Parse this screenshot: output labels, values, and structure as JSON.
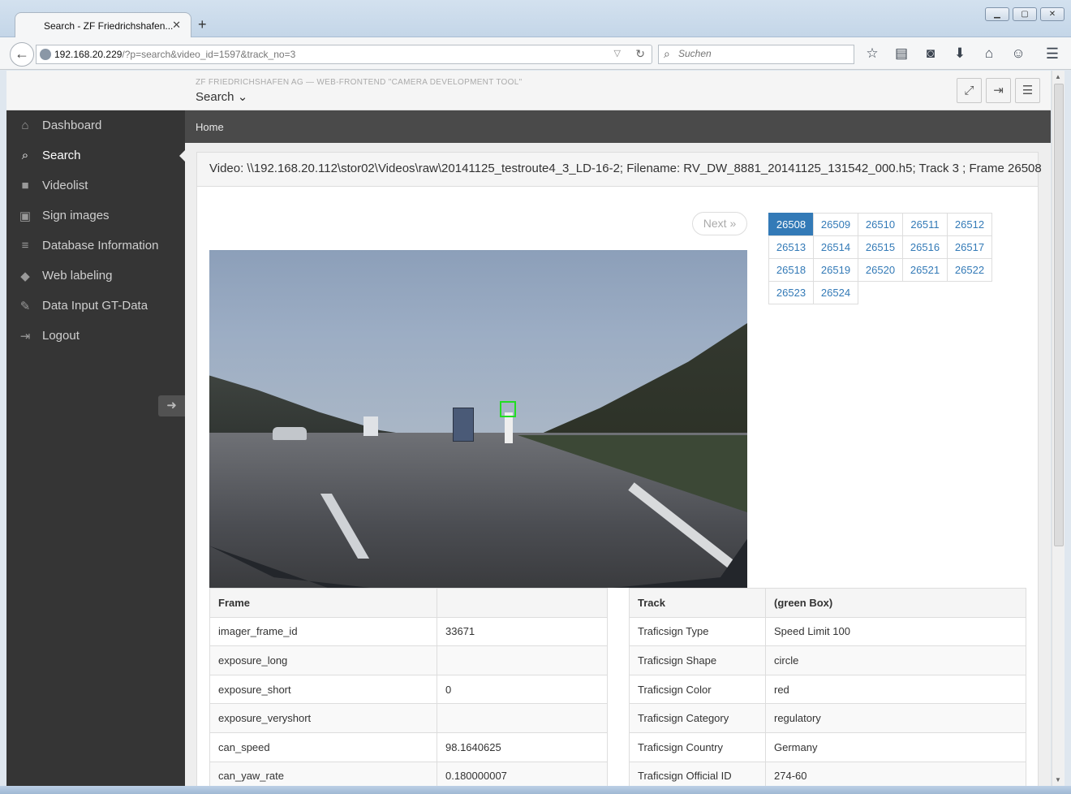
{
  "browser": {
    "tab_title": "Search - ZF Friedrichshafen...",
    "url_host": "192.168.20.229",
    "url_path": "/?p=search&video_id=1597&track_no=3",
    "search_placeholder": "Suchen"
  },
  "header": {
    "subtitle": "ZF FRIEDRICHSHAFEN AG — WEB-FRONTEND \"CAMERA DEVELOPMENT TOOL\"",
    "title": "Search"
  },
  "sidebar": {
    "items": [
      {
        "label": "Dashboard",
        "icon": "home-icon"
      },
      {
        "label": "Search",
        "icon": "search-icon"
      },
      {
        "label": "Videolist",
        "icon": "video-camera-icon"
      },
      {
        "label": "Sign images",
        "icon": "image-icon"
      },
      {
        "label": "Database Information",
        "icon": "database-icon"
      },
      {
        "label": "Web labeling",
        "icon": "tag-icon"
      },
      {
        "label": "Data Input GT-Data",
        "icon": "pencil-icon"
      },
      {
        "label": "Logout",
        "icon": "sign-out-icon"
      }
    ],
    "active": "Search"
  },
  "breadcrumb": "Home",
  "panel": {
    "heading": "Video: \\\\192.168.20.112\\stor02\\Videos\\raw\\20141125_testroute4_3_LD-16-2; Filename: RV_DW_8881_20141125_131542_000.h5; Track 3 ; Frame 26508",
    "next_label": "Next »"
  },
  "frames": [
    "26508",
    "26509",
    "26510",
    "26511",
    "26512",
    "26513",
    "26514",
    "26515",
    "26516",
    "26517",
    "26518",
    "26519",
    "26520",
    "26521",
    "26522",
    "26523",
    "26524"
  ],
  "active_frame": "26508",
  "frame_table": {
    "header": [
      "Frame",
      ""
    ],
    "rows": [
      [
        "imager_frame_id",
        "33671"
      ],
      [
        "exposure_long",
        ""
      ],
      [
        "exposure_short",
        "0"
      ],
      [
        "exposure_veryshort",
        ""
      ],
      [
        "can_speed",
        "98.1640625"
      ],
      [
        "can_yaw_rate",
        "0.180000007"
      ]
    ]
  },
  "track_table": {
    "header": [
      "Track",
      "(green Box)"
    ],
    "rows": [
      [
        "Traficsign Type",
        "Speed Limit 100"
      ],
      [
        "Traficsign Shape",
        "circle"
      ],
      [
        "Traficsign Color",
        "red"
      ],
      [
        "Traficsign Category",
        "regulatory"
      ],
      [
        "Traficsign Country",
        "Germany"
      ],
      [
        "Traficsign Official ID",
        "274-60"
      ]
    ]
  },
  "colors": {
    "sidebar_bg": "#353535",
    "breadcrumb_bg": "#4a4a4a",
    "accent": "#337ab7",
    "detection_box": "#22dd22"
  }
}
